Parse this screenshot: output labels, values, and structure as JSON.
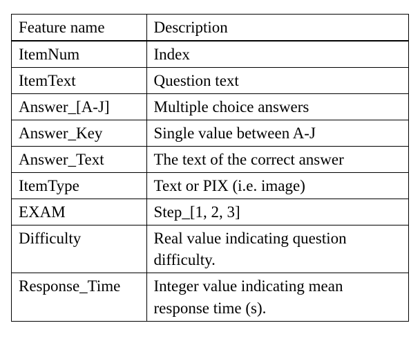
{
  "table": {
    "headers": {
      "col1": "Feature name",
      "col2": "Description"
    },
    "rows": [
      {
        "feature": "ItemNum",
        "description": "Index"
      },
      {
        "feature": "ItemText",
        "description": "Question text"
      },
      {
        "feature": "Answer_[A-J]",
        "description": "Multiple choice answers"
      },
      {
        "feature": "Answer_Key",
        "description": "Single value between A-J"
      },
      {
        "feature": "Answer_Text",
        "description": "The text of the correct answer"
      },
      {
        "feature": "ItemType",
        "description": "Text or PIX (i.e. image)"
      },
      {
        "feature": "EXAM",
        "description": "Step_[1, 2, 3]"
      },
      {
        "feature": "Difficulty",
        "description": "Real value indicating question difficulty."
      },
      {
        "feature": "Response_Time",
        "description": "Integer value indicating mean response time (s)."
      }
    ]
  }
}
